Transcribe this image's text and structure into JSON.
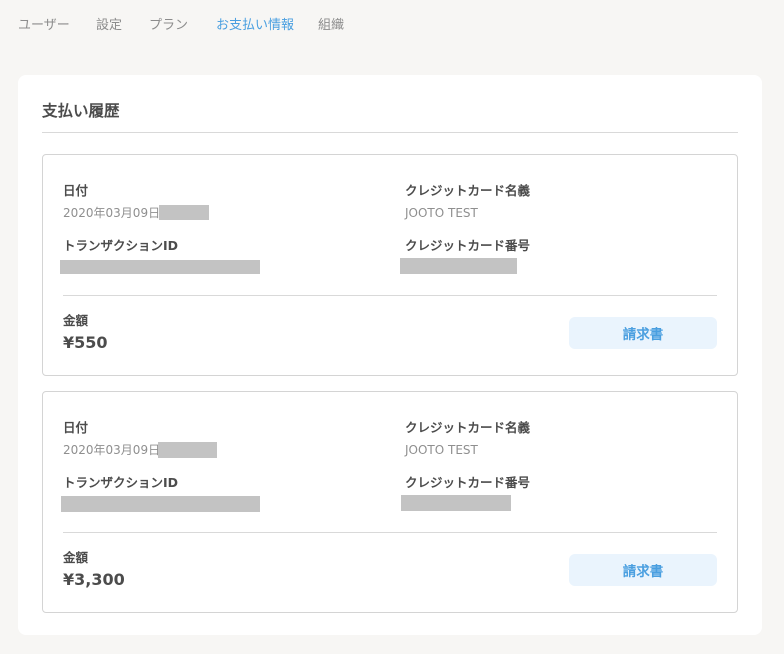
{
  "nav": {
    "tabs": [
      {
        "label": "ユーザー"
      },
      {
        "label": "設定"
      },
      {
        "label": "プラン"
      },
      {
        "label": "お支払い情報"
      },
      {
        "label": "組織"
      }
    ],
    "active_tab": "お支払い情報"
  },
  "payment_history": {
    "title": "支払い履歴",
    "records": [
      {
        "date_label": "日付",
        "date_value": "2020年03月09日",
        "card_name_label": "クレジットカード名義",
        "card_name_value": "JOOTO TEST",
        "transaction_label": "トランザクションID",
        "card_number_label": "クレジットカード番号",
        "amount_label": "金額",
        "amount_value": "¥550",
        "invoice_label": "請求書"
      },
      {
        "date_label": "日付",
        "date_value": "2020年03月09日",
        "card_name_label": "クレジットカード名義",
        "card_name_value": "JOOTO TEST",
        "transaction_label": "トランザクションID",
        "card_number_label": "クレジットカード番号",
        "amount_label": "金額",
        "amount_value": "¥3,300",
        "invoice_label": "請求書"
      }
    ]
  },
  "colors": {
    "accent": "#4a9fe0",
    "button_bg": "#eaf4fd",
    "redacted": "#c3c3c3",
    "page_bg": "#f7f6f4"
  }
}
